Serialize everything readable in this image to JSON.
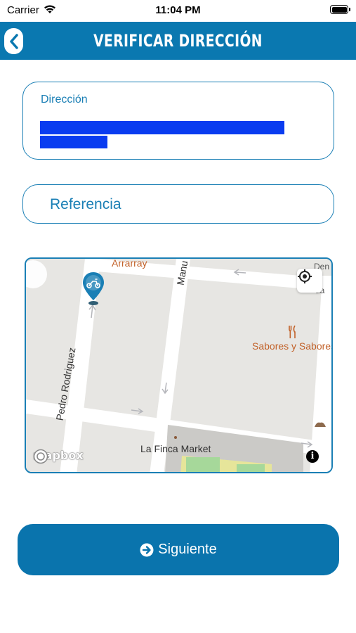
{
  "status_bar": {
    "carrier": "Carrier",
    "time": "11:04 PM"
  },
  "header": {
    "title": "VERIFICAR DIRECCIÓN",
    "back_icon": "chevron-left-icon"
  },
  "address_field": {
    "label": "Dirección",
    "value_redacted": true
  },
  "reference_field": {
    "placeholder": "Referencia",
    "value": ""
  },
  "map": {
    "street_labels": [
      "Pedro Rodriguez",
      "Manu"
    ],
    "poi_labels": [
      "Arrarray",
      "Sabores y Sabores",
      "La Finca Market"
    ],
    "edge_labels": [
      "Den",
      "ua"
    ],
    "attribution": "mapbox",
    "info_label": "i",
    "marker_icon": "scooter-pin-icon",
    "locate_icon": "location-crosshair-icon"
  },
  "next_button": {
    "label": "Siguiente",
    "icon": "arrow-circle-right-icon"
  },
  "colors": {
    "primary": "#0a78b0",
    "accent_text": "#1a7fb5",
    "poi": "#c2622a"
  }
}
